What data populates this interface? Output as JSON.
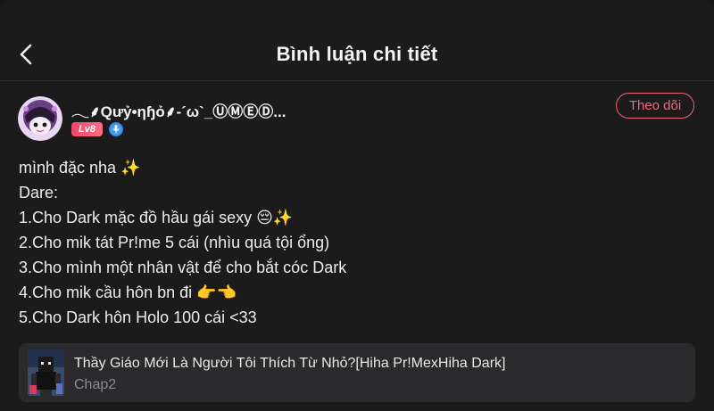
{
  "header": {
    "title": "Bình luận chi tiết"
  },
  "author": {
    "name": "𓂃⸙Qưỷ•ηɧỏ⸙-´ω`_ⓊⓂⒺⒹ...",
    "level": "Lv8",
    "verified_icon": "verified-voice-icon",
    "follow_label": "Theo dõi"
  },
  "comment": {
    "lines": [
      "mình đặc nha ✨",
      "Dare:",
      "1.Cho Dark mặc đồ hầu gái sexy 😔✨",
      "2.Cho mik tát Pr!me 5 cái (nhìu quá tội ổng)",
      "3.Cho mình một nhân vật để cho bắt cóc Dark",
      "4.Cho mik cầu hôn bn đi 👉👈",
      "5.Cho Dark hôn Holo 100 cái <33"
    ]
  },
  "story": {
    "title": "Thầy Giáo Mới Là Người Tôi Thích Từ Nhỏ?[Hiha Pr!MexHiha Dark]",
    "chapter": "Chap2"
  },
  "colors": {
    "background": "#1b1b1c",
    "accent": "#ef5f77",
    "card": "#2a2a2c",
    "muted_text": "#8c8c8e"
  }
}
